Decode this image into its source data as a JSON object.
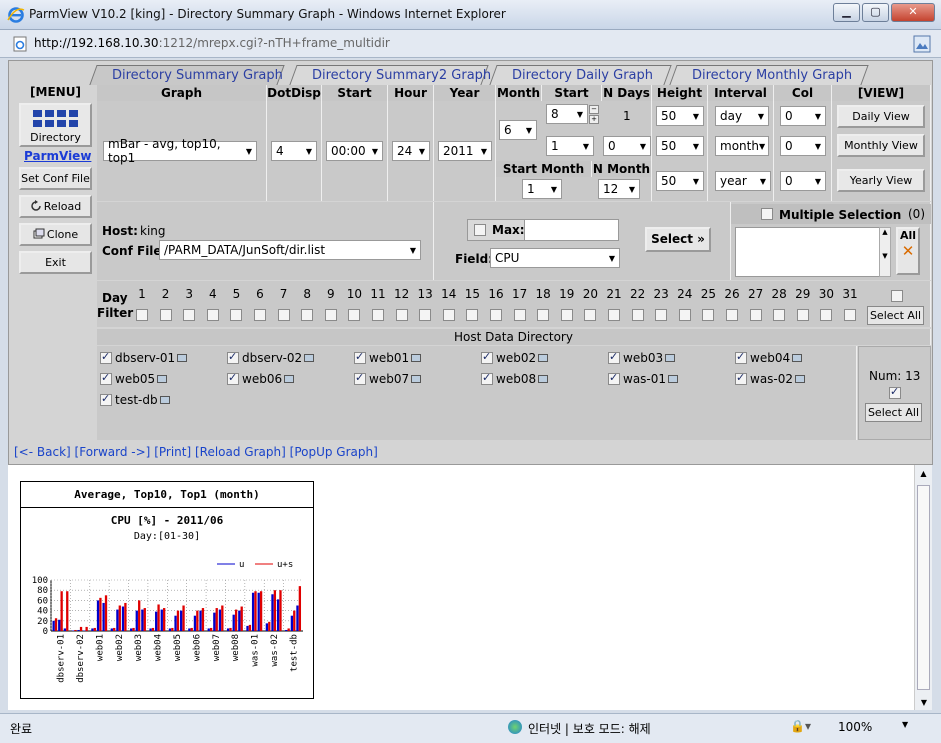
{
  "window": {
    "title": "ParmView V10.2 [king] - Directory Summary Graph - Windows Internet Explorer",
    "url_host": "http://192.168.10.30",
    "url_rest": ":1212/mrepx.cgi?-nTH+frame_multidir"
  },
  "tabs": [
    {
      "label": "Directory Summary Graph",
      "active": true
    },
    {
      "label": "Directory Summary2 Graph",
      "active": false
    },
    {
      "label": "Directory Daily Graph",
      "active": false
    },
    {
      "label": "Directory Monthly Graph",
      "active": false
    }
  ],
  "menu": {
    "head": "[MENU]",
    "directory": "Directory",
    "parmview": "ParmView",
    "set_conf": "Set Conf File",
    "reload": "Reload",
    "clone": "Clone",
    "exit": "Exit"
  },
  "headers": {
    "graph": "Graph",
    "dotdisp": "DotDisp",
    "start_hour": "Start hour",
    "hour": "Hour",
    "year": "Year",
    "month": "Month",
    "start_day": "Start Day",
    "n_days": "N Days",
    "height": "Height",
    "interval": "Interval",
    "col": "Col",
    "view": "[VIEW]"
  },
  "values": {
    "graph": "mBar - avg, top10, top1",
    "dotdisp": "4",
    "start_hour": "00:00",
    "hour": "24",
    "year": "2011",
    "month": "6",
    "start_day": "8",
    "n_days": "1",
    "day2": "1",
    "nd2": "0",
    "height1": "50",
    "height2": "50",
    "height3": "50",
    "interval1": "day",
    "interval2": "month",
    "interval3": "year",
    "col1": "0",
    "col2": "0",
    "col3": "0",
    "start_month_label": "Start Month",
    "n_month_label": "N Month",
    "start_month": "1",
    "n_month": "12"
  },
  "views": {
    "daily": "Daily View",
    "monthly": "Monthly View",
    "yearly": "Yearly View"
  },
  "host_section": {
    "host_label": "Host:",
    "host": "king",
    "conf_label": "Conf File:",
    "conf": "/PARM_DATA/JunSoft/dir.list",
    "max_label": "Max:",
    "field_label": "Field:",
    "field": "CPU",
    "select_btn": "Select",
    "multi_label": "Multiple Selection",
    "multi_count": "(0)",
    "all": "All"
  },
  "day_filter": {
    "label1": "Day",
    "label2": "Filter",
    "days": [
      "1",
      "2",
      "3",
      "4",
      "5",
      "6",
      "7",
      "8",
      "9",
      "10",
      "11",
      "12",
      "13",
      "14",
      "15",
      "16",
      "17",
      "18",
      "19",
      "20",
      "21",
      "22",
      "23",
      "24",
      "25",
      "26",
      "27",
      "28",
      "29",
      "30",
      "31"
    ],
    "select_all": "Select All"
  },
  "host_dir": {
    "title": "Host Data Directory",
    "hosts": [
      "dbserv-01",
      "dbserv-02",
      "web01",
      "web02",
      "web03",
      "web04",
      "web05",
      "web06",
      "web07",
      "web08",
      "was-01",
      "was-02",
      "test-db"
    ],
    "num_label": "Num: 13",
    "select_all": "Select All"
  },
  "nav": {
    "back": "[<- Back]",
    "forward": "[Forward ->]",
    "print": "[Print]",
    "reload": "[Reload Graph]",
    "popup": "[PopUp Graph]"
  },
  "chart_data": {
    "type": "bar",
    "header": "Average, Top10, Top1 (month)",
    "title": "CPU [%] - 2011/06",
    "subtitle": "Day:[01-30]",
    "categories": [
      "dbserv-01",
      "dbserv-02",
      "web01",
      "web02",
      "web03",
      "web04",
      "web05",
      "web06",
      "web07",
      "web08",
      "was-01",
      "was-02",
      "test-db"
    ],
    "series": [
      {
        "name": "u",
        "color": "#0000cc",
        "values": [
          [
            20,
            22,
            5
          ],
          [
            1,
            2,
            1
          ],
          [
            5,
            60,
            55
          ],
          [
            5,
            42,
            48
          ],
          [
            5,
            40,
            42
          ],
          [
            5,
            38,
            42
          ],
          [
            5,
            30,
            40
          ],
          [
            5,
            30,
            40
          ],
          [
            5,
            36,
            42
          ],
          [
            5,
            32,
            40
          ],
          [
            10,
            75,
            75
          ],
          [
            15,
            72,
            62
          ],
          [
            2,
            30,
            50
          ]
        ]
      },
      {
        "name": "u+s",
        "color": "#e00000",
        "values": [
          [
            25,
            78,
            78
          ],
          [
            2,
            8,
            8
          ],
          [
            6,
            65,
            70
          ],
          [
            6,
            50,
            55
          ],
          [
            6,
            60,
            45
          ],
          [
            6,
            52,
            45
          ],
          [
            6,
            40,
            50
          ],
          [
            6,
            40,
            45
          ],
          [
            6,
            45,
            50
          ],
          [
            6,
            42,
            48
          ],
          [
            12,
            78,
            78
          ],
          [
            18,
            80,
            80
          ],
          [
            5,
            40,
            88
          ]
        ]
      }
    ],
    "ylim": [
      0,
      100
    ],
    "yticks": [
      "100",
      "80",
      "60",
      "40",
      "20",
      "0"
    ]
  },
  "status": {
    "left": "완료",
    "zone": "인터넷 | 보호 모드: 해제",
    "zoom": "100%"
  }
}
